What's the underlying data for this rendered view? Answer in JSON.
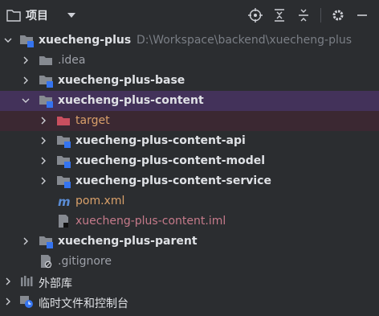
{
  "toolbar": {
    "title": "项目",
    "icons": [
      "project-folder-icon",
      "dropdown-icon",
      "locate-icon",
      "expand-all-icon",
      "collapse-all-icon",
      "gear-icon",
      "hide-icon"
    ]
  },
  "tree": {
    "root": {
      "label": "xuecheng-plus",
      "path": "D:\\Workspace\\backend\\xuecheng-plus"
    },
    "idea": ".idea",
    "base": "xuecheng-plus-base",
    "content": "xuecheng-plus-content",
    "target": "target",
    "content_api": "xuecheng-plus-content-api",
    "content_model": "xuecheng-plus-content-model",
    "content_service": "xuecheng-plus-content-service",
    "pom": "pom.xml",
    "iml": "xuecheng-plus-content.iml",
    "parent": "xuecheng-plus-parent",
    "gitignore": ".gitignore",
    "external_libraries": "外部库",
    "scratches": "临时文件和控制台"
  },
  "colors": {
    "background": "#2b2d30",
    "selected_row": "#43325a",
    "excluded_row": "#3b2832",
    "module_badge": "#3574f0",
    "excluded_folder": "#c94f5f"
  }
}
